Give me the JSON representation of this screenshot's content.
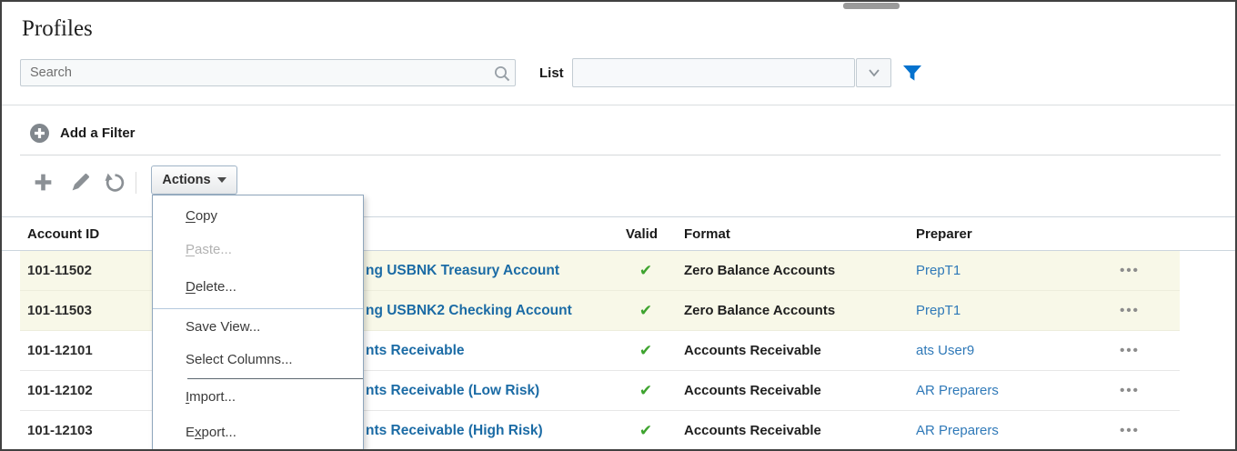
{
  "colors": {
    "accent_blue": "#0572ce",
    "name_link_blue": "#1b6ba5",
    "preparer_link_blue": "#2f79b8",
    "valid_green": "#3da32e",
    "row_highlight": "#f8f8e8"
  },
  "header": {
    "title": "Profiles"
  },
  "search": {
    "placeholder": "Search"
  },
  "list_filter": {
    "label": "List",
    "value": ""
  },
  "filter_bar": {
    "add_filter_label": "Add a Filter"
  },
  "toolbar": {
    "actions_label": "Actions"
  },
  "actions_menu": {
    "items": [
      {
        "pre": "",
        "key": "C",
        "post": "opy",
        "enabled": true
      },
      {
        "pre": "",
        "key": "P",
        "post": "aste...",
        "enabled": false
      },
      {
        "pre": "",
        "key": "D",
        "post": "elete...",
        "enabled": true
      },
      {
        "pre": "Save View...",
        "key": "",
        "post": "",
        "enabled": true
      },
      {
        "pre": "Select Columns...",
        "key": "",
        "post": "",
        "enabled": true
      },
      {
        "pre": "",
        "key": "I",
        "post": "mport...",
        "enabled": true
      },
      {
        "pre": "E",
        "key": "x",
        "post": "port...",
        "enabled": true
      }
    ]
  },
  "table": {
    "columns": [
      "Account ID",
      "Valid",
      "Format",
      "Preparer"
    ],
    "rows": [
      {
        "account_id": "101-11502",
        "name_visible": "ng USBNK Treasury Account",
        "valid": true,
        "format": "Zero Balance Accounts",
        "preparer": "PrepT1",
        "highlighted": true
      },
      {
        "account_id": "101-11503",
        "name_visible": "ng USBNK2 Checking Account",
        "valid": true,
        "format": "Zero Balance Accounts",
        "preparer": "PrepT1",
        "highlighted": true
      },
      {
        "account_id": "101-12101",
        "name_visible": "nts Receivable",
        "valid": true,
        "format": "Accounts Receivable",
        "preparer": "ats User9",
        "highlighted": false
      },
      {
        "account_id": "101-12102",
        "name_visible": "nts Receivable (Low Risk)",
        "valid": true,
        "format": "Accounts Receivable",
        "preparer": "AR Preparers",
        "highlighted": false
      },
      {
        "account_id": "101-12103",
        "name_visible": "nts Receivable (High Risk)",
        "valid": true,
        "format": "Accounts Receivable",
        "preparer": "AR Preparers",
        "highlighted": false
      }
    ]
  },
  "icons": {
    "check": "✔",
    "row_menu": "•••"
  }
}
